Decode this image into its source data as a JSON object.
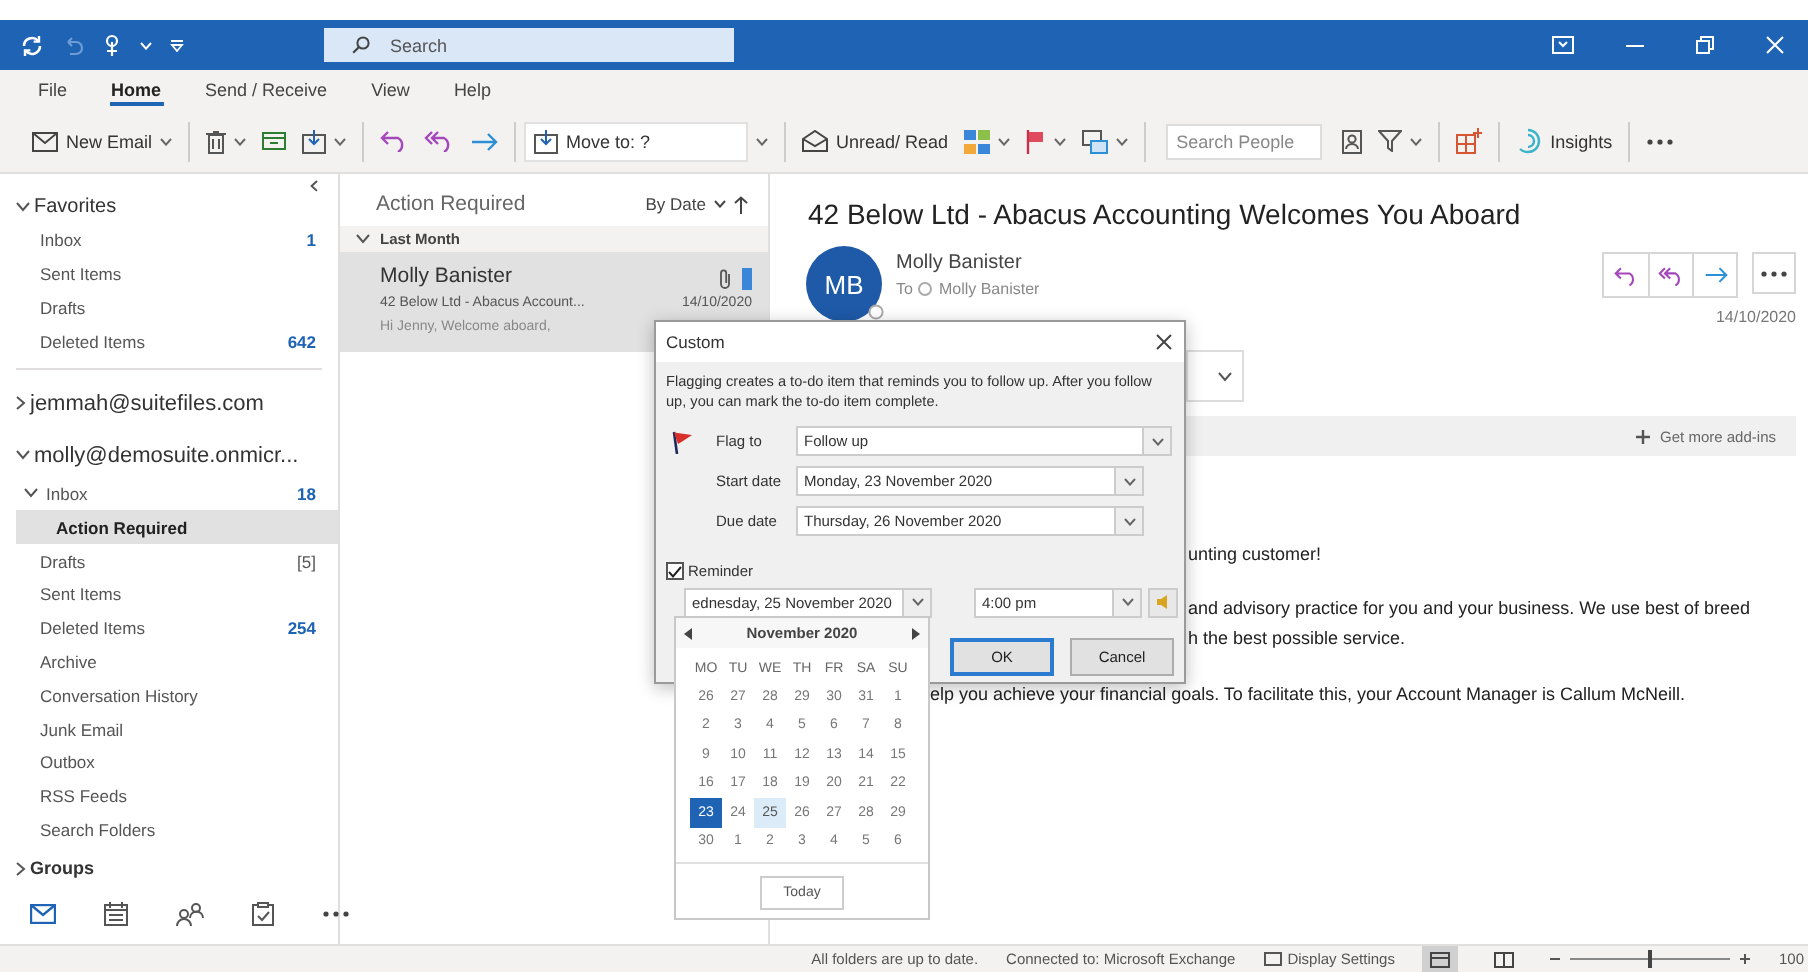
{
  "title_bar": {
    "search": {
      "placeholder": "Search"
    }
  },
  "menu_tabs": [
    {
      "label": "File",
      "selected": false
    },
    {
      "label": "Home",
      "selected": true
    },
    {
      "label": "Send / Receive",
      "selected": false
    },
    {
      "label": "View",
      "selected": false
    },
    {
      "label": "Help",
      "selected": false
    }
  ],
  "toolbar": {
    "new_email": "New Email",
    "move_to": "Move to: ?",
    "unread_read": "Unread/ Read",
    "search_people": {
      "placeholder": "Search People"
    },
    "insights": "Insights"
  },
  "folder_pane": {
    "sections": [
      {
        "label": "Favorites",
        "kind": "heading",
        "expanded": true,
        "items": [
          {
            "label": "Inbox",
            "count": {
              "text": "1",
              "kind": "unread"
            },
            "selected": false
          },
          {
            "label": "Sent Items",
            "selected": false
          },
          {
            "label": "Drafts",
            "selected": false
          },
          {
            "label": "Deleted Items",
            "count": {
              "text": "642",
              "kind": "unread"
            },
            "selected": false
          }
        ]
      },
      {
        "label": "jemmah@suitefiles.com",
        "kind": "account",
        "expanded": false
      },
      {
        "label": "molly@demosuite.onmicr...",
        "kind": "account",
        "expanded": true,
        "items": [
          {
            "label": "Inbox",
            "count": {
              "text": "18",
              "kind": "unread"
            },
            "selected": false,
            "expanded": true,
            "children": [
              {
                "label": "Action Required",
                "selected": true
              }
            ]
          },
          {
            "label": "Drafts",
            "count": {
              "text": "[5]",
              "kind": "total"
            },
            "selected": false
          },
          {
            "label": "Sent Items",
            "selected": false
          },
          {
            "label": "Deleted Items",
            "count": {
              "text": "254",
              "kind": "unread"
            },
            "selected": false
          },
          {
            "label": "Archive",
            "selected": false
          },
          {
            "label": "Conversation History",
            "selected": false
          },
          {
            "label": "Junk Email",
            "selected": false
          },
          {
            "label": "Outbox",
            "selected": false
          },
          {
            "label": "RSS Feeds",
            "selected": false
          },
          {
            "label": "Search Folders",
            "selected": false
          }
        ]
      },
      {
        "label": "Groups",
        "kind": "heading",
        "expanded": false
      }
    ]
  },
  "message_list": {
    "title": "Action Required",
    "sort": "By Date",
    "groups": [
      {
        "label": "Last Month",
        "expanded": true,
        "messages": [
          {
            "sender": "Molly Banister",
            "subject": "42 Below Ltd - Abacus Account...",
            "date": "14/10/2020",
            "preview": "Hi Jenny, Welcome aboard,",
            "selected": true,
            "attachment": true,
            "flagged": true
          }
        ]
      }
    ]
  },
  "reading_pane": {
    "subject": "42 Below Ltd - Abacus Accounting Welcomes You Aboard",
    "initials": "MB",
    "sender": "Molly Banister",
    "to_label": "To",
    "recipient": "Molly Banister",
    "date": "14/10/2020",
    "add_ins": "Get more add-ins",
    "body": [
      {
        "text": "unting customer!",
        "kind": "beside_dialog"
      },
      {
        "text": "and advisory practice for you and your business. We use best of breed",
        "kind": "beside_dialog"
      },
      {
        "text": "h the best possible service.",
        "kind": "beside_dialog"
      },
      {
        "text": "elp you achieve your financial goals. To facilitate this, your Account Manager is Callum McNeill.",
        "kind": "beside_calendar"
      }
    ]
  },
  "dialog": {
    "title": "Custom",
    "description": "Flagging creates a to-do item that reminds you to follow up. After you follow up, you can mark the to-do item complete.",
    "fields": [
      {
        "label": "Flag to",
        "value": "Follow up",
        "kind": "flag"
      },
      {
        "label": "Start date",
        "value": "Monday, 23 November 2020",
        "kind": "date"
      },
      {
        "label": "Due date",
        "value": "Thursday, 26 November 2020",
        "kind": "date"
      }
    ],
    "reminder": {
      "label": "Reminder",
      "checked": true,
      "date": "ednesday, 25 November 2020",
      "time": "4:00 pm"
    },
    "buttons": [
      {
        "label": "OK",
        "default": true
      },
      {
        "label": "Cancel",
        "default": false
      }
    ]
  },
  "calendar": {
    "month": "November 2020",
    "weekdays": [
      "MO",
      "TU",
      "WE",
      "TH",
      "FR",
      "SA",
      "SU"
    ],
    "days": [
      {
        "day": "26",
        "today": false,
        "selected": false
      },
      {
        "day": "27",
        "today": false,
        "selected": false
      },
      {
        "day": "28",
        "today": false,
        "selected": false
      },
      {
        "day": "29",
        "today": false,
        "selected": false
      },
      {
        "day": "30",
        "today": false,
        "selected": false
      },
      {
        "day": "31",
        "today": false,
        "selected": false
      },
      {
        "day": "1",
        "today": false,
        "selected": false
      },
      {
        "day": "2",
        "today": false,
        "selected": false
      },
      {
        "day": "3",
        "today": false,
        "selected": false
      },
      {
        "day": "4",
        "today": false,
        "selected": false
      },
      {
        "day": "5",
        "today": false,
        "selected": false
      },
      {
        "day": "6",
        "today": false,
        "selected": false
      },
      {
        "day": "7",
        "today": false,
        "selected": false
      },
      {
        "day": "8",
        "today": false,
        "selected": false
      },
      {
        "day": "9",
        "today": false,
        "selected": false
      },
      {
        "day": "10",
        "today": false,
        "selected": false
      },
      {
        "day": "11",
        "today": false,
        "selected": false
      },
      {
        "day": "12",
        "today": false,
        "selected": false
      },
      {
        "day": "13",
        "today": false,
        "selected": false
      },
      {
        "day": "14",
        "today": false,
        "selected": false
      },
      {
        "day": "15",
        "today": false,
        "selected": false
      },
      {
        "day": "16",
        "today": false,
        "selected": false
      },
      {
        "day": "17",
        "today": false,
        "selected": false
      },
      {
        "day": "18",
        "today": false,
        "selected": false
      },
      {
        "day": "19",
        "today": false,
        "selected": false
      },
      {
        "day": "20",
        "today": false,
        "selected": false
      },
      {
        "day": "21",
        "today": false,
        "selected": false
      },
      {
        "day": "22",
        "today": false,
        "selected": false
      },
      {
        "day": "23",
        "today": true,
        "selected": false
      },
      {
        "day": "24",
        "today": false,
        "selected": false
      },
      {
        "day": "25",
        "today": false,
        "selected": true
      },
      {
        "day": "26",
        "today": false,
        "selected": false
      },
      {
        "day": "27",
        "today": false,
        "selected": false
      },
      {
        "day": "28",
        "today": false,
        "selected": false
      },
      {
        "day": "29",
        "today": false,
        "selected": false
      },
      {
        "day": "30",
        "today": false,
        "selected": false
      },
      {
        "day": "1",
        "today": false,
        "selected": false
      },
      {
        "day": "2",
        "today": false,
        "selected": false
      },
      {
        "day": "3",
        "today": false,
        "selected": false
      },
      {
        "day": "4",
        "today": false,
        "selected": false
      },
      {
        "day": "5",
        "today": false,
        "selected": false
      },
      {
        "day": "6",
        "today": false,
        "selected": false
      }
    ],
    "today_button": "Today"
  },
  "status_bar": {
    "sync": "All folders are up to date.",
    "connection": "Connected to: Microsoft Exchange",
    "display_settings": "Display Settings",
    "zoom": {
      "level": 0.5,
      "reading": "100"
    }
  }
}
